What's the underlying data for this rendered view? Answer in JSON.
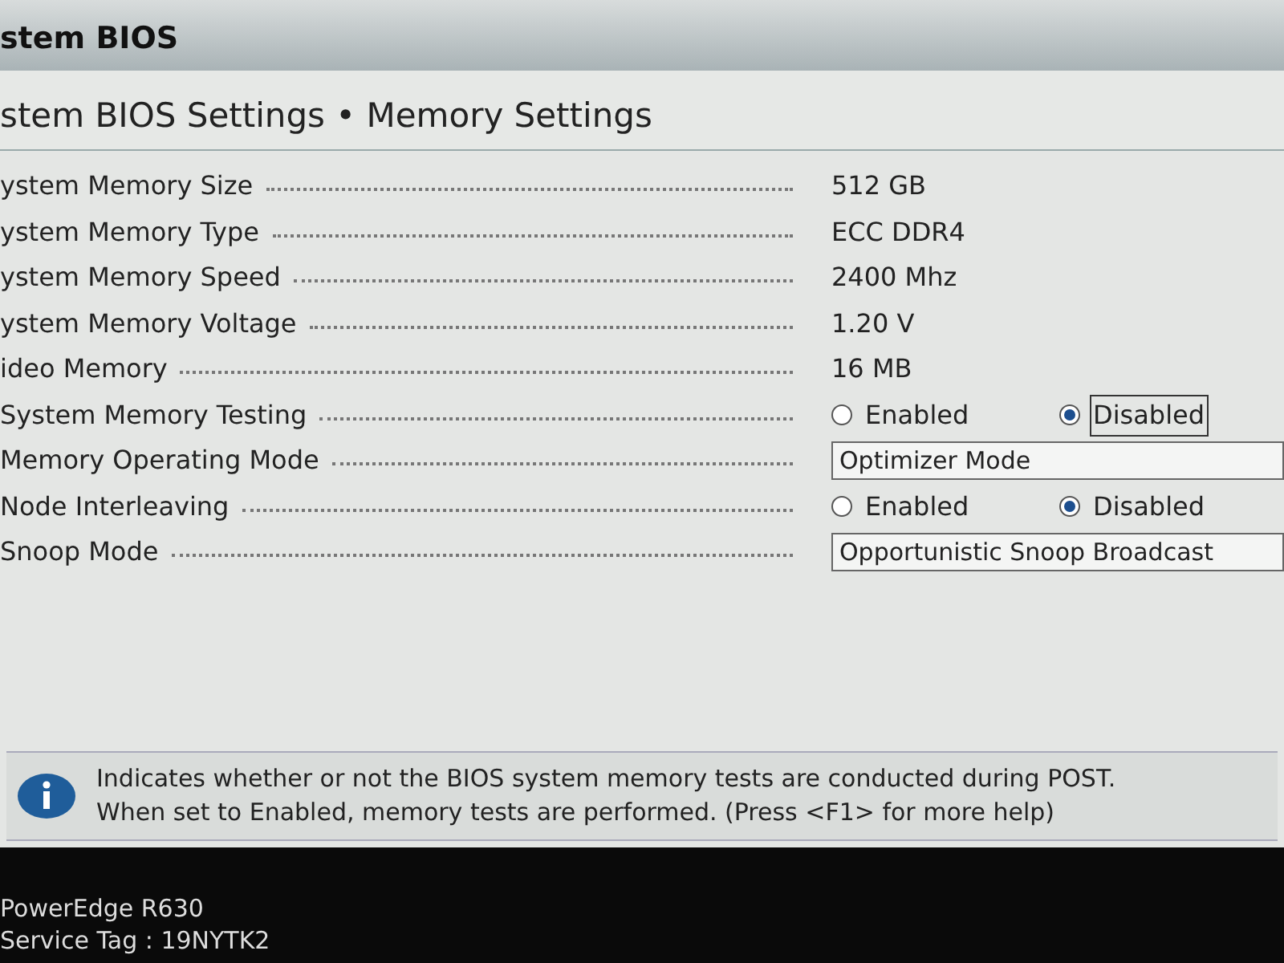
{
  "window": {
    "title": "stem BIOS"
  },
  "breadcrumb": "stem BIOS Settings • Memory Settings",
  "settings": [
    {
      "kind": "text",
      "label": "ystem Memory Size",
      "value": "512 GB"
    },
    {
      "kind": "text",
      "label": "ystem Memory Type",
      "value": "ECC DDR4"
    },
    {
      "kind": "text",
      "label": "ystem Memory Speed",
      "value": "2400 Mhz"
    },
    {
      "kind": "text",
      "label": "ystem Memory Voltage",
      "value": "1.20 V"
    },
    {
      "kind": "text",
      "label": "ideo Memory",
      "value": "16 MB"
    },
    {
      "kind": "radio",
      "label": "System Memory Testing",
      "options": [
        {
          "label": "Enabled",
          "selected": false,
          "focused": false
        },
        {
          "label": "Disabled",
          "selected": true,
          "focused": true
        }
      ]
    },
    {
      "kind": "select",
      "label": "Memory Operating Mode",
      "value": "Optimizer Mode"
    },
    {
      "kind": "radio",
      "label": "Node Interleaving",
      "options": [
        {
          "label": "Enabled",
          "selected": false,
          "focused": false
        },
        {
          "label": "Disabled",
          "selected": true,
          "focused": false
        }
      ]
    },
    {
      "kind": "select",
      "label": "Snoop Mode",
      "value": "Opportunistic Snoop Broadcast"
    }
  ],
  "help": [
    "Indicates whether or not the BIOS system memory tests are conducted during POST.",
    "When set to Enabled, memory tests are performed. (Press <F1> for more help)"
  ],
  "footer": [
    "PowerEdge R630",
    "Service Tag : 19NYTK2"
  ]
}
